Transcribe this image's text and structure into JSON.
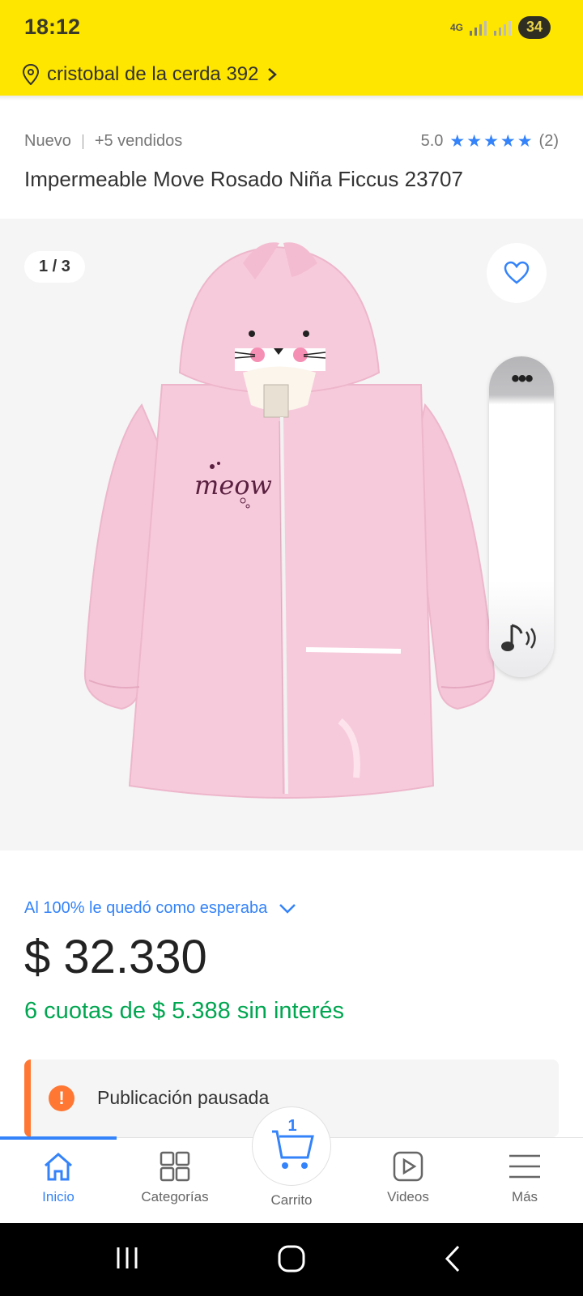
{
  "status": {
    "time": "18:12",
    "network": "4G",
    "battery": "34"
  },
  "address": {
    "text": "cristobal de la cerda 392"
  },
  "product": {
    "condition": "Nuevo",
    "sold": "+5 vendidos",
    "rating_value": "5.0",
    "rating_count": "(2)",
    "rating_stars": 5,
    "title": "Impermeable Move Rosado Niña Ficcus 23707"
  },
  "gallery": {
    "counter": "1 / 3",
    "print_text": "meow"
  },
  "reputation": {
    "text": "Al 100% le quedó como esperaba"
  },
  "pricing": {
    "price": "$ 32.330",
    "installments": "6 cuotas de $ 5.388 sin interés"
  },
  "notice": {
    "text": "Publicación pausada"
  },
  "tabbar": {
    "home": "Inicio",
    "categories": "Categorías",
    "cart": "Carrito",
    "cart_count": "1",
    "videos": "Videos",
    "more": "Más"
  },
  "colors": {
    "brand_yellow": "#ffe600",
    "accent_blue": "#3483fa",
    "green": "#00a650",
    "warning_orange": "#ff7733"
  }
}
